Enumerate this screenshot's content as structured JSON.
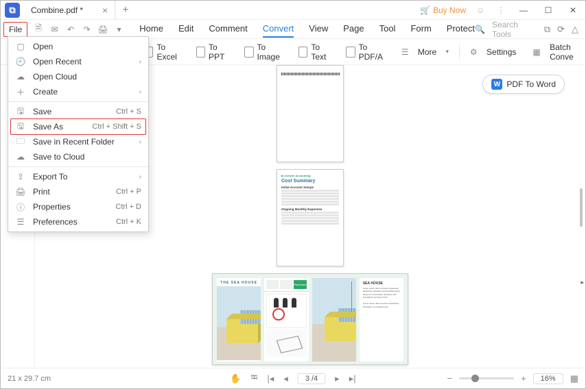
{
  "titlebar": {
    "tab_title": "Combine.pdf *",
    "buy_now": "Buy Now"
  },
  "ribbon1": {
    "file": "File",
    "tabs": [
      "Home",
      "Edit",
      "Comment",
      "Convert",
      "View",
      "Page",
      "Tool",
      "Form",
      "Protect"
    ],
    "active_index": 3,
    "search_placeholder": "Search Tools"
  },
  "ribbon2": {
    "to_excel": "To Excel",
    "to_ppt": "To PPT",
    "to_image": "To Image",
    "to_text": "To Text",
    "to_pdfa": "To PDF/A",
    "more": "More",
    "settings": "Settings",
    "batch": "Batch Conve"
  },
  "file_menu": {
    "open": "Open",
    "open_recent": "Open Recent",
    "open_cloud": "Open Cloud",
    "create": "Create",
    "save": "Save",
    "save_short": "Ctrl + S",
    "save_as": "Save As",
    "save_as_short": "Ctrl + Shift + S",
    "save_recent_folder": "Save in Recent Folder",
    "save_cloud": "Save to Cloud",
    "export_to": "Export To",
    "print": "Print",
    "print_short": "Ctrl + P",
    "properties": "Properties",
    "properties_short": "Ctrl + D",
    "preferences": "Preferences",
    "preferences_short": "Ctrl + K"
  },
  "page_area": {
    "pdf_to_word": "PDF To Word",
    "thumb2_logo": "■ Livewire Accounting",
    "thumb2_title": "Cost Summary",
    "thumb2_sect1": "Initial Account Setups",
    "thumb2_sect2": "Ongoing Monthly Expenses",
    "thumb3_p1_title": "THE SEA HOUSE",
    "thumb3_p2_tag": "Placement"
  },
  "statusbar": {
    "dims": "21 x 29.7 cm",
    "page": "3 /4",
    "zoom": "16%"
  }
}
